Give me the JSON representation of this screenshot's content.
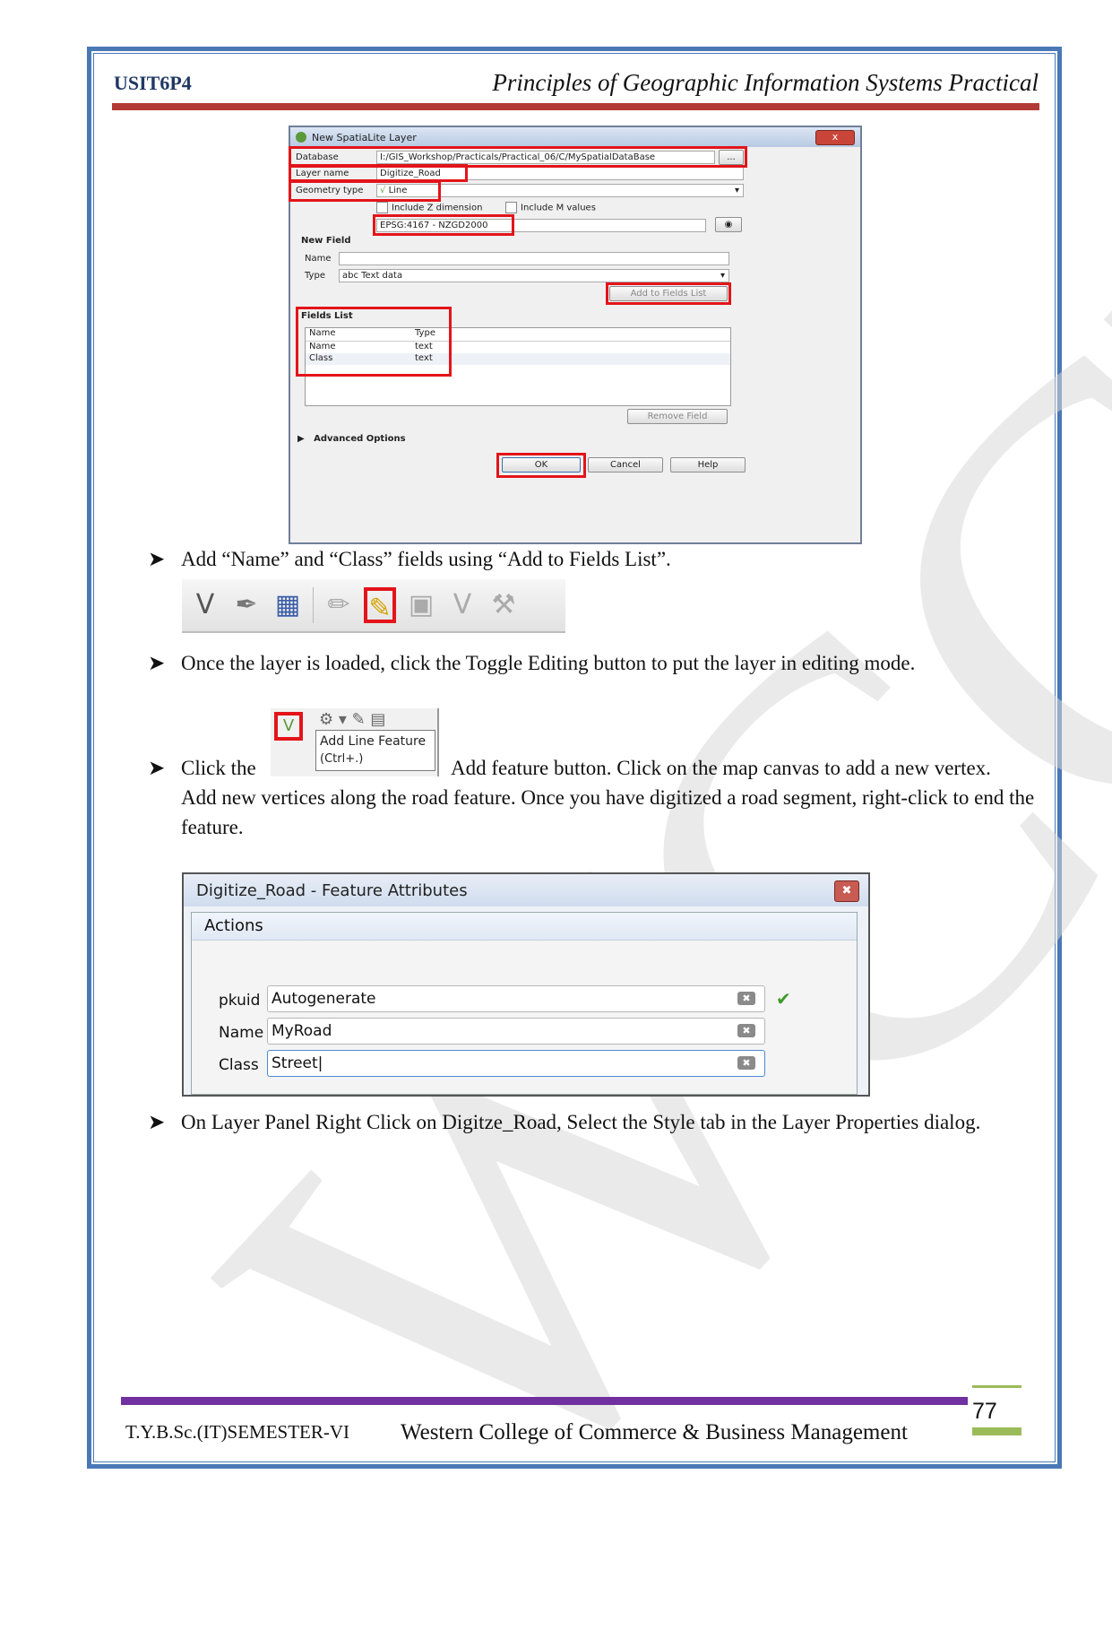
{
  "header": {
    "code": "USIT6P4",
    "title": "Principles of Geographic Information Systems Practical"
  },
  "watermark": "WCCBM",
  "qgis_dialog": {
    "title": "New SpatiaLite Layer",
    "close": "x",
    "database_label": "Database",
    "database_value": "I:/GIS_Workshop/Practicals/Practical_06/C/MySpatialDataBase",
    "browse": "...",
    "layer_name_label": "Layer name",
    "layer_name_value": "Digitize_Road",
    "geometry_label": "Geometry type",
    "geometry_value": "Line",
    "include_z": "Include Z dimension",
    "include_m": "Include M values",
    "crs": "EPSG:4167 - NZGD2000",
    "new_field_title": "New Field",
    "name_label": "Name",
    "type_label": "Type",
    "type_value": "abc Text data",
    "add_to_fields": "Add to Fields List",
    "fields_list_title": "Fields List",
    "fields_columns": [
      "Name",
      "Type"
    ],
    "fields_rows": [
      {
        "name": "Name",
        "type": "text"
      },
      {
        "name": "Class",
        "type": "text"
      }
    ],
    "remove_field": "Remove Field",
    "advanced": "Advanced Options",
    "ok": "OK",
    "cancel": "Cancel",
    "help": "Help"
  },
  "bullets": {
    "b1": "Add “Name” and “Class” fields using “Add to Fields List”.",
    "b2": "Once the layer is loaded, click the Toggle Editing button to put the layer in editing mode.",
    "b3_start": "Click the",
    "b3_rest": "Add feature button. Click on the map canvas to add a new vertex.",
    "b3_cont": "Add new vertices along the road feature. Once you have digitized a road segment, right-click to end the feature.",
    "b4": "On Layer Panel Right Click on Digitze_Road, Select the Style tab in the Layer Properties dialog."
  },
  "tooltip": {
    "title": "Add Line Feature",
    "shortcut": "(Ctrl+.)"
  },
  "feature_attributes": {
    "title": "Digitize_Road - Feature Attributes",
    "actions": "Actions",
    "fields": [
      {
        "label": "pkuid",
        "value": "Autogenerate"
      },
      {
        "label": "Name",
        "value": "MyRoad"
      },
      {
        "label": "Class",
        "value": "Street"
      }
    ]
  },
  "footer": {
    "left": "T.Y.B.Sc.(IT)SEMESTER-VI",
    "center": "Western College of Commerce & Business Management",
    "page": "77"
  }
}
